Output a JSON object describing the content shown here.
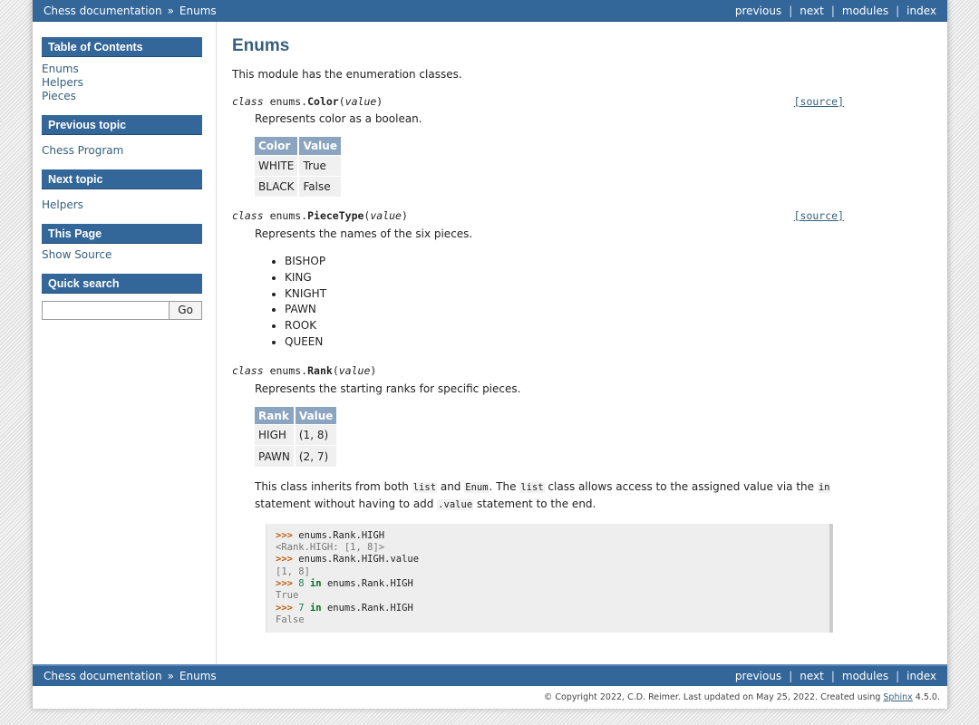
{
  "relbar": {
    "crumbs": [
      "Chess documentation",
      "Enums"
    ],
    "crumb_sep": "»",
    "nav": [
      "previous",
      "next",
      "modules",
      "index"
    ],
    "nav_sep": "|"
  },
  "sidebar": {
    "toc_title": "Table of Contents",
    "toc_links": [
      "Enums",
      "Helpers",
      "Pieces"
    ],
    "prev_title": "Previous topic",
    "prev_link": "Chess Program",
    "next_title": "Next topic",
    "next_link": "Helpers",
    "this_page_title": "This Page",
    "show_source": "Show Source",
    "search_title": "Quick search",
    "search_button": "Go",
    "search_value": ""
  },
  "main": {
    "title": "Enums",
    "intro": "This module has the enumeration classes.",
    "source_label": "[source]",
    "color": {
      "kw": "class",
      "mod": "enums.",
      "name": "Color",
      "lparen": "(",
      "arg": "value",
      "rparen": ")",
      "desc": "Represents color as a boolean.",
      "headers": [
        "Color",
        "Value"
      ],
      "rows": [
        [
          "WHITE",
          "True"
        ],
        [
          "BLACK",
          "False"
        ]
      ]
    },
    "piecetype": {
      "kw": "class",
      "mod": "enums.",
      "name": "PieceType",
      "lparen": "(",
      "arg": "value",
      "rparen": ")",
      "desc": "Represents the names of the six pieces.",
      "items": [
        "BISHOP",
        "KING",
        "KNIGHT",
        "PAWN",
        "ROOK",
        "QUEEN"
      ]
    },
    "rank": {
      "kw": "class",
      "mod": "enums.",
      "name": "Rank",
      "lparen": "(",
      "arg": "value",
      "rparen": ")",
      "desc": "Represents the starting ranks for specific pieces.",
      "headers": [
        "Rank",
        "Value"
      ],
      "rows": [
        [
          "HIGH",
          "(1, 8)"
        ],
        [
          "PAWN",
          "(2, 7)"
        ]
      ],
      "inherit_parts": [
        "This class inherits from both ",
        "list",
        " and ",
        "Enum",
        ". The ",
        "list",
        " class allows access to the assigned value via the ",
        "in",
        " statement without having to add ",
        ".value",
        " statement to the end."
      ]
    },
    "code": {
      "prompt": ">>>",
      "l1": "enums.Rank.HIGH",
      "o1": "<Rank.HIGH: [1, 8]>",
      "l2": "enums.Rank.HIGH.value",
      "o2": "[1, 8]",
      "l3_num": "8",
      "l3_kw": "in",
      "l3_rest": "enums.Rank.HIGH",
      "o3": "True",
      "l4_num": "7",
      "l4_kw": "in",
      "l4_rest": "enums.Rank.HIGH",
      "o4": "False"
    }
  },
  "footer": {
    "text": "© Copyright 2022, C.D. Reimer. Last updated on May 25, 2022. Created using ",
    "link": "Sphinx",
    "version": " 4.5.0."
  },
  "colors": {
    "bar": "#336699",
    "link": "#355f7c",
    "table_header": "#8ba4c0"
  }
}
